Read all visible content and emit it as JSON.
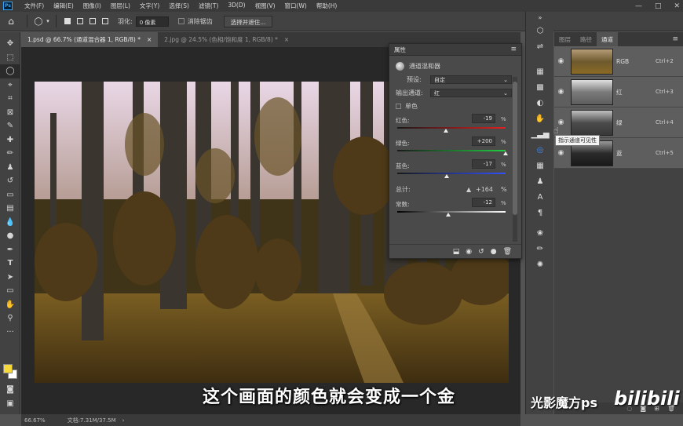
{
  "menubar": {
    "logo": "Ps",
    "items": [
      "文件(F)",
      "编辑(E)",
      "图像(I)",
      "图层(L)",
      "文字(Y)",
      "选择(S)",
      "滤镜(T)",
      "3D(D)",
      "视图(V)",
      "窗口(W)",
      "帮助(H)"
    ]
  },
  "options": {
    "feather_label": "羽化:",
    "feather_value": "0 像素",
    "antialias_label": "消除锯齿",
    "select_mask_label": "选择并遮住..."
  },
  "tabs": [
    {
      "label": "1.psd @ 66.7% (通道混合器 1, RGB/8) *",
      "close": "×"
    },
    {
      "label": "2.jpg @ 24.5% (色相/饱和度 1, RGB/8) *",
      "close": "×"
    }
  ],
  "status": {
    "zoom": "66.67%",
    "doc": "文档:7.31M/37.5M"
  },
  "properties": {
    "title": "属性",
    "subtitle": "通道混和器",
    "preset_label": "预设:",
    "preset_value": "自定",
    "output_label": "输出通道:",
    "output_value": "红",
    "mono_label": "单色",
    "sliders": [
      {
        "label": "红色:",
        "value": "-19",
        "pct": "%",
        "pos": -0.19,
        "track_colors": [
          "#1a1a1a",
          "#e02020"
        ]
      },
      {
        "label": "绿色:",
        "value": "+200",
        "pct": "%",
        "pos": 2.0,
        "track_colors": [
          "#1a1a1a",
          "#20d040"
        ]
      },
      {
        "label": "蓝色:",
        "value": "-17",
        "pct": "%",
        "pos": -0.17,
        "track_colors": [
          "#1a1a1a",
          "#3050ff"
        ]
      }
    ],
    "total_label": "总计:",
    "total_value": "+164",
    "total_pct": "%",
    "constant": {
      "label": "常数:",
      "value": "-12",
      "pct": "%",
      "pos": -0.12,
      "track_colors": [
        "#000000",
        "#ffffff"
      ]
    }
  },
  "channels_panel": {
    "tabs": [
      "图层",
      "路径",
      "通道"
    ],
    "active_tab": 2,
    "channels": [
      {
        "name": "RGB",
        "shortcut": "Ctrl+2",
        "tone": "color"
      },
      {
        "name": "红",
        "shortcut": "Ctrl+3",
        "tone": "gray-light"
      },
      {
        "name": "绿",
        "shortcut": "Ctrl+4",
        "tone": "gray-mid"
      },
      {
        "name": "蓝",
        "shortcut": "Ctrl+5",
        "tone": "gray-dark"
      }
    ],
    "tooltip": "指示通道可见性"
  },
  "overlay": {
    "subtitle": "这个画面的颜色就会变成一个金",
    "watermark": "光影魔方ps",
    "brand": "bilibili"
  },
  "colors": {
    "foreground": "#f5d93a",
    "background": "#ffffff",
    "accent": "#31a8ff"
  }
}
